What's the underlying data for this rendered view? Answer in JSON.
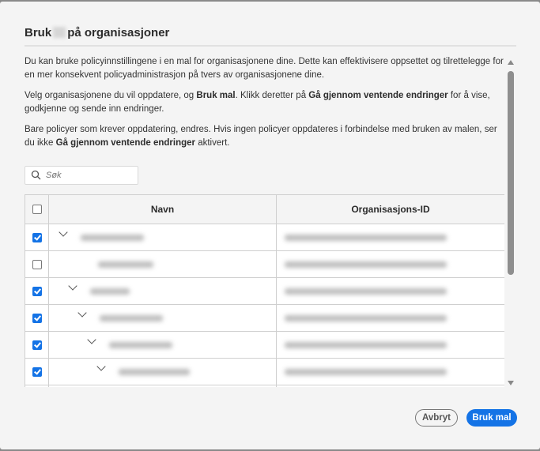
{
  "dialog": {
    "title_prefix": "Bruk",
    "title_suffix": "på organisasjoner",
    "paragraphs": {
      "p1": "Du kan bruke policyinnstillingene i en mal for organisasjonene dine. Dette kan effektivisere oppsettet og tilrettelegge for en mer konsekvent policyadministrasjon på tvers av organisasjonene dine.",
      "p2a": "Velg organisasjonene du vil oppdatere, og ",
      "p2b": "Bruk mal",
      "p2c": ". Klikk deretter på ",
      "p2d": "Gå gjennom ventende endringer",
      "p2e": " for å vise, godkjenne og sende inn endringer.",
      "p3a": "Bare policyer som krever oppdatering, endres. Hvis ingen policyer oppdateres i forbindelse med bruken av malen, ser du ikke ",
      "p3b": "Gå gjennom ventende endringer",
      "p3c": " aktivert."
    },
    "search": {
      "placeholder": "Søk",
      "icon": "search-icon"
    },
    "table": {
      "columns": [
        "Navn",
        "Organisasjons-ID"
      ],
      "rows": [
        {
          "checked": true,
          "level": 0,
          "expandable": true
        },
        {
          "checked": false,
          "level": 1,
          "expandable": false
        },
        {
          "checked": true,
          "level": 1,
          "expandable": true
        },
        {
          "checked": true,
          "level": 2,
          "expandable": true
        },
        {
          "checked": true,
          "level": 3,
          "expandable": true
        },
        {
          "checked": true,
          "level": 4,
          "expandable": true
        },
        {
          "checked": true,
          "level": 5,
          "expandable": false
        }
      ]
    },
    "buttons": {
      "cancel": "Avbryt",
      "apply": "Bruk mal"
    },
    "colors": {
      "accent": "#1473e6",
      "background": "#f4f4f4"
    }
  }
}
